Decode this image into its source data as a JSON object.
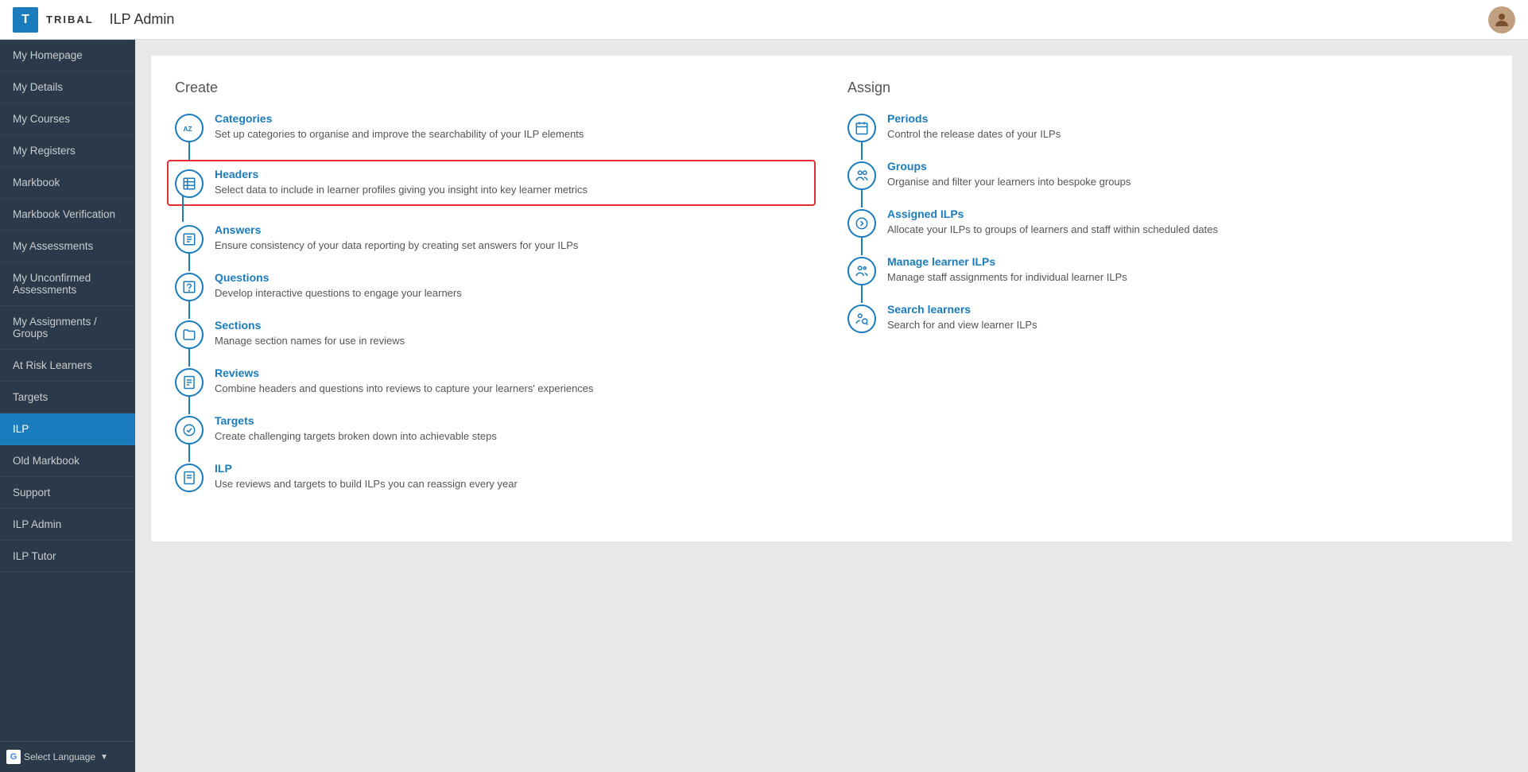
{
  "header": {
    "logo_letter": "T",
    "logo_name": "TRIBAL",
    "page_title": "ILP Admin"
  },
  "sidebar": {
    "items": [
      {
        "id": "my-homepage",
        "label": "My Homepage",
        "active": false
      },
      {
        "id": "my-details",
        "label": "My Details",
        "active": false
      },
      {
        "id": "my-courses",
        "label": "My Courses",
        "active": false
      },
      {
        "id": "my-registers",
        "label": "My Registers",
        "active": false
      },
      {
        "id": "markbook",
        "label": "Markbook",
        "active": false
      },
      {
        "id": "markbook-verification",
        "label": "Markbook Verification",
        "active": false
      },
      {
        "id": "my-assessments",
        "label": "My Assessments",
        "active": false
      },
      {
        "id": "my-unconfirmed-assessments",
        "label": "My Unconfirmed Assessments",
        "active": false
      },
      {
        "id": "my-assignments-groups",
        "label": "My Assignments / Groups",
        "active": false
      },
      {
        "id": "at-risk-learners",
        "label": "At Risk Learners",
        "active": false
      },
      {
        "id": "targets",
        "label": "Targets",
        "active": false
      },
      {
        "id": "ilp",
        "label": "ILP",
        "active": true
      },
      {
        "id": "old-markbook",
        "label": "Old Markbook",
        "active": false
      },
      {
        "id": "support",
        "label": "Support",
        "active": false
      },
      {
        "id": "ilp-admin",
        "label": "ILP Admin",
        "active": false
      },
      {
        "id": "ilp-tutor",
        "label": "ILP Tutor",
        "active": false
      }
    ],
    "footer": {
      "select_language": "Select Language",
      "dropdown_arrow": "▼"
    }
  },
  "create_section": {
    "heading": "Create",
    "items": [
      {
        "id": "categories",
        "icon": "az",
        "label": "Categories",
        "description": "Set up categories to organise and improve the searchability of your ILP elements",
        "highlighted": false
      },
      {
        "id": "headers",
        "icon": "table",
        "label": "Headers",
        "description": "Select data to include in learner profiles giving you insight into key learner metrics",
        "highlighted": true
      },
      {
        "id": "answers",
        "icon": "list",
        "label": "Answers",
        "description": "Ensure consistency of your data reporting by creating set answers for your ILPs",
        "highlighted": false
      },
      {
        "id": "questions",
        "icon": "question",
        "label": "Questions",
        "description": "Develop interactive questions to engage your learners",
        "highlighted": false
      },
      {
        "id": "sections",
        "icon": "folder",
        "label": "Sections",
        "description": "Manage section names for use in reviews",
        "highlighted": false
      },
      {
        "id": "reviews",
        "icon": "doc",
        "label": "Reviews",
        "description": "Combine headers and questions into reviews to capture your learners' experiences",
        "highlighted": false
      },
      {
        "id": "targets",
        "icon": "check",
        "label": "Targets",
        "description": "Create challenging targets broken down into achievable steps",
        "highlighted": false
      },
      {
        "id": "ilp",
        "icon": "doc2",
        "label": "ILP",
        "description": "Use reviews and targets to build ILPs you can reassign every year",
        "highlighted": false
      }
    ]
  },
  "assign_section": {
    "heading": "Assign",
    "items": [
      {
        "id": "periods",
        "icon": "calendar",
        "label": "Periods",
        "description": "Control the release dates of your ILPs",
        "highlighted": false
      },
      {
        "id": "groups",
        "icon": "people",
        "label": "Groups",
        "description": "Organise and filter your learners into bespoke groups",
        "highlighted": false
      },
      {
        "id": "assigned-ilps",
        "icon": "arrow",
        "label": "Assigned ILPs",
        "description": "Allocate your ILPs to groups of learners and staff within scheduled dates",
        "highlighted": false
      },
      {
        "id": "manage-learner-ilps",
        "icon": "people2",
        "label": "Manage learner ILPs",
        "description": "Manage staff assignments for individual learner ILPs",
        "highlighted": false
      },
      {
        "id": "search-learners",
        "icon": "search-people",
        "label": "Search learners",
        "description": "Search for and view learner ILPs",
        "highlighted": false
      }
    ]
  }
}
